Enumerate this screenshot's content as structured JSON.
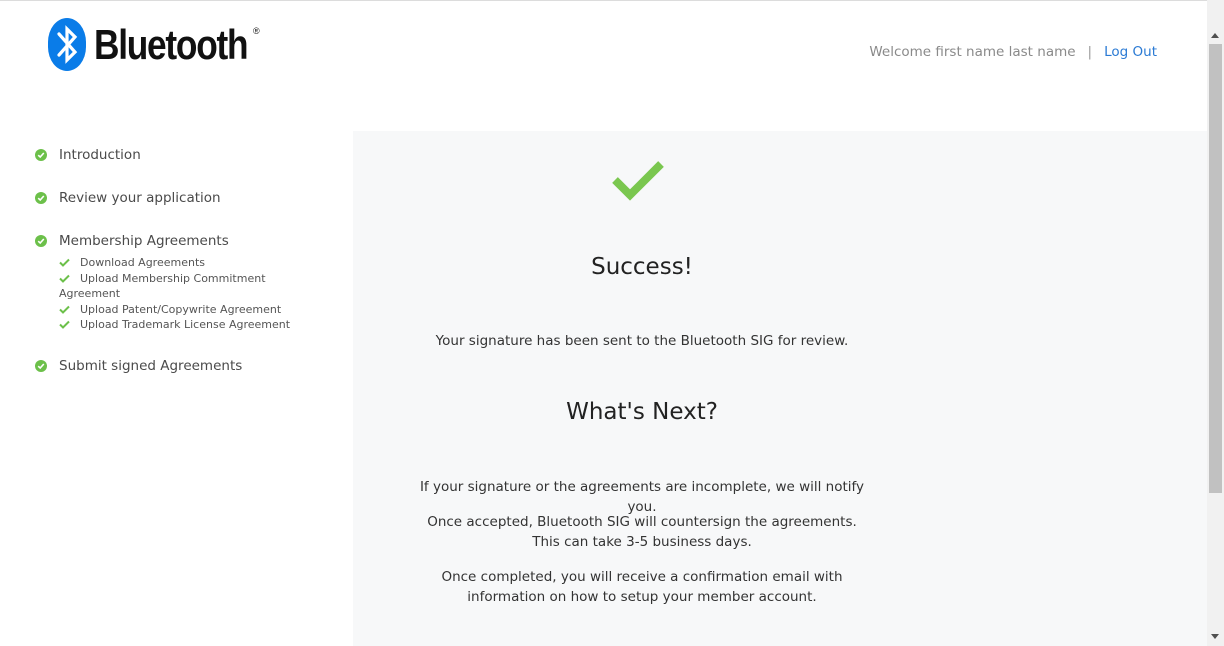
{
  "header": {
    "logo_text": "Bluetooth",
    "logo_mark": "®",
    "welcome": "Welcome first name last name",
    "separator": "|",
    "logout_label": "Log Out",
    "link_color": "#2a7ad4"
  },
  "sidebar": {
    "steps": [
      {
        "label": "Introduction",
        "icon": "check-circle-icon"
      },
      {
        "label": "Review your application",
        "icon": "check-circle-icon"
      },
      {
        "label": "Membership Agreements",
        "icon": "check-circle-icon"
      },
      {
        "label": "Submit signed Agreements",
        "icon": "check-circle-icon"
      }
    ],
    "substeps": [
      {
        "label": "Download Agreements",
        "icon": "check-icon"
      },
      {
        "label": "Upload Membership Commitment Agreement",
        "icon": "check-icon"
      },
      {
        "label": "Upload Patent/Copywrite Agreement",
        "icon": "check-icon"
      },
      {
        "label": "Upload Trademark License Agreement",
        "icon": "check-icon"
      }
    ],
    "check_color": "#6cc04a"
  },
  "main": {
    "success_icon": "large-check-icon",
    "success_title": "Success!",
    "success_message": "Your signature has been sent to the Bluetooth SIG for review.",
    "next_title": "What's Next?",
    "next_paragraphs": [
      "If your signature or the agreements are incomplete, we will notify you.",
      "Once accepted, Bluetooth SIG will countersign the agreements. This can take 3-5 business days.",
      "Once completed, you will receive a confirmation email with information on how to setup your member account."
    ]
  }
}
